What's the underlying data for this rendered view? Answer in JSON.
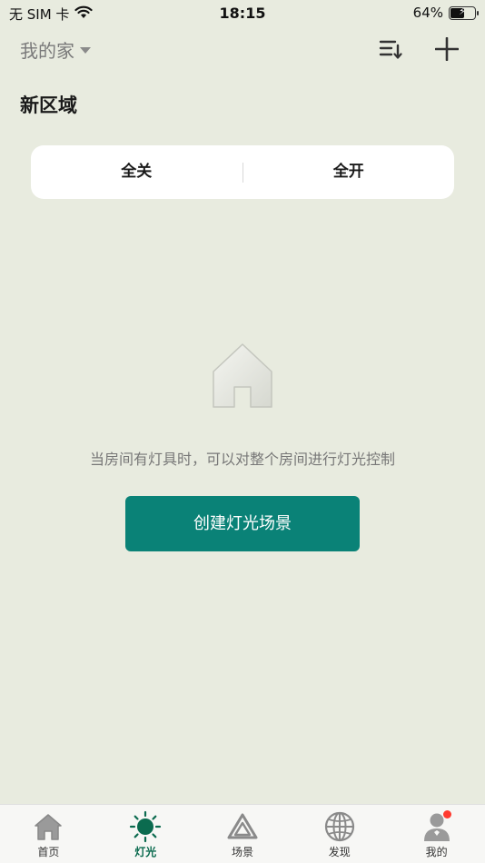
{
  "status_bar": {
    "carrier": "无 SIM 卡",
    "time": "18:15",
    "battery_percent": "64%",
    "battery_level": 0.64
  },
  "header": {
    "home_name": "我的家",
    "sort_icon": "sort-icon",
    "add_icon": "plus-icon"
  },
  "area": {
    "title": "新区域"
  },
  "toggle": {
    "all_off": "全关",
    "all_on": "全开"
  },
  "empty_state": {
    "icon": "house-icon",
    "message": "当房间有灯具时，可以对整个房间进行灯光控制",
    "button_label": "创建灯光场景"
  },
  "tabs": [
    {
      "label": "首页",
      "icon": "home-icon",
      "active": false
    },
    {
      "label": "灯光",
      "icon": "light-icon",
      "active": true
    },
    {
      "label": "场景",
      "icon": "scene-icon",
      "active": false
    },
    {
      "label": "发现",
      "icon": "discover-icon",
      "active": false
    },
    {
      "label": "我的",
      "icon": "profile-icon",
      "active": false,
      "badge": true
    }
  ],
  "colors": {
    "background": "#e8ebdf",
    "accent": "#0a8277",
    "active_tab": "#0b6b4f",
    "badge": "#ff3b30"
  }
}
